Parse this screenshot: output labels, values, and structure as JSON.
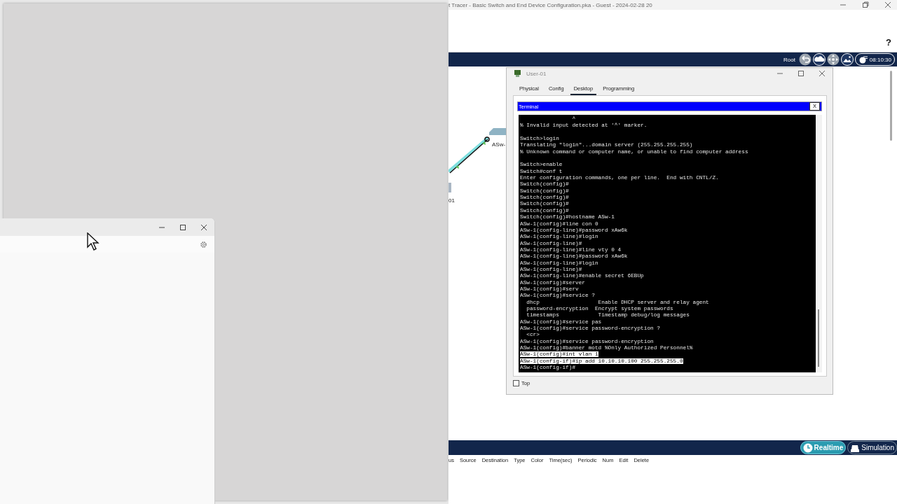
{
  "app_window": {
    "title": "t Tracer - Basic Switch and End Device Configuration.pka - Guest - 2024-02-28 20",
    "help": "?",
    "navbar": {
      "root": "Root",
      "time": "08:10:30"
    },
    "canvas_labels": [
      "ASw-",
      "01"
    ],
    "mode_buttons": [
      {
        "label": "Realtime",
        "selected": true
      },
      {
        "label": "Simulation",
        "selected": false
      }
    ],
    "pdu_columns": [
      "us",
      "Source",
      "Destination",
      "Type",
      "Color",
      "Time(sec)",
      "Periodic",
      "Num",
      "Edit",
      "Delete"
    ]
  },
  "device_window": {
    "title": "User-01",
    "tabs": [
      {
        "label": "Physical",
        "selected": false
      },
      {
        "label": "Config",
        "selected": false
      },
      {
        "label": "Desktop",
        "selected": true
      },
      {
        "label": "Programming",
        "selected": false
      }
    ],
    "terminal": {
      "title": "Terminal",
      "close": "X",
      "lines": [
        {
          "text": "                ^",
          "selected": false,
          "gap_before": false
        },
        {
          "text": "% Invalid input detected at '^' marker.",
          "selected": false,
          "gap_before": false
        },
        {
          "text": "Switch>login",
          "selected": false,
          "gap_before": true
        },
        {
          "text": "Translating \"login\"...domain server (255.255.255.255)",
          "selected": false,
          "gap_before": false
        },
        {
          "text": "% Unknown command or computer name, or unable to find computer address",
          "selected": false,
          "gap_before": false
        },
        {
          "text": "Switch>enable",
          "selected": false,
          "gap_before": true
        },
        {
          "text": "Switch#conf t",
          "selected": false,
          "gap_before": false
        },
        {
          "text": "Enter configuration commands, one per line.  End with CNTL/Z.",
          "selected": false,
          "gap_before": false
        },
        {
          "text": "Switch(config)#",
          "selected": false,
          "gap_before": false
        },
        {
          "text": "Switch(config)#",
          "selected": false,
          "gap_before": false
        },
        {
          "text": "Switch(config)#",
          "selected": false,
          "gap_before": false
        },
        {
          "text": "Switch(config)#",
          "selected": false,
          "gap_before": false
        },
        {
          "text": "Switch(config)#",
          "selected": false,
          "gap_before": false
        },
        {
          "text": "Switch(config)#hostname ASw-1",
          "selected": false,
          "gap_before": false
        },
        {
          "text": "ASw-1(config)#line con 0",
          "selected": false,
          "gap_before": false
        },
        {
          "text": "ASw-1(config-line)#password xAw6k",
          "selected": false,
          "gap_before": false
        },
        {
          "text": "ASw-1(config-line)#login",
          "selected": false,
          "gap_before": false
        },
        {
          "text": "ASw-1(config-line)#",
          "selected": false,
          "gap_before": false
        },
        {
          "text": "ASw-1(config-line)#line vty 0 4",
          "selected": false,
          "gap_before": false
        },
        {
          "text": "ASw-1(config-line)#password xAw6k",
          "selected": false,
          "gap_before": false
        },
        {
          "text": "ASw-1(config-line)#login",
          "selected": false,
          "gap_before": false
        },
        {
          "text": "ASw-1(config-line)#",
          "selected": false,
          "gap_before": false
        },
        {
          "text": "ASw-1(config-line)#enable secret 6EBUp",
          "selected": false,
          "gap_before": false
        },
        {
          "text": "ASw-1(config)#server",
          "selected": false,
          "gap_before": false
        },
        {
          "text": "ASw-1(config)#serv",
          "selected": false,
          "gap_before": false
        },
        {
          "text": "ASw-1(config)#service ?",
          "selected": false,
          "gap_before": false
        },
        {
          "text": "  dhcp                  Enable DHCP server and relay agent",
          "selected": false,
          "gap_before": false
        },
        {
          "text": "  password-encryption  Encrypt system passwords",
          "selected": false,
          "gap_before": false
        },
        {
          "text": "  timestamps            Timestamp debug/log messages",
          "selected": false,
          "gap_before": false
        },
        {
          "text": "ASw-1(config)#service pas",
          "selected": false,
          "gap_before": false
        },
        {
          "text": "ASw-1(config)#service password-encryption ?",
          "selected": false,
          "gap_before": false
        },
        {
          "text": "  <cr>",
          "selected": false,
          "gap_before": false
        },
        {
          "text": "ASw-1(config)#service password-encryption",
          "selected": false,
          "gap_before": false
        },
        {
          "text": "ASw-1(config)#banner motd %Only Authorized Personnel%",
          "selected": false,
          "gap_before": false
        },
        {
          "text": "ASw-1(config)#int vlan 1",
          "selected": true,
          "gap_before": false
        },
        {
          "text": "ASw-1(config-if)#ip add 10.10.10.100 255.255.255.0",
          "selected": true,
          "gap_before": false
        },
        {
          "text": "ASw-1(config-if)#",
          "selected": false,
          "gap_before": false
        }
      ]
    },
    "top_checkbox": {
      "label": "Top",
      "checked": false
    }
  }
}
